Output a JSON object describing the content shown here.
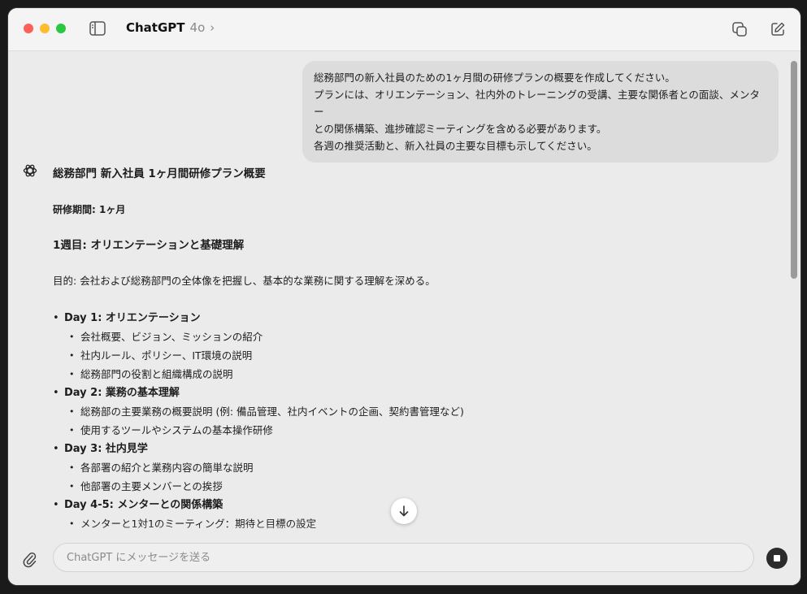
{
  "titlebar": {
    "app_name": "ChatGPT",
    "model": "4o",
    "model_chevron": "›"
  },
  "user_message": {
    "lines": [
      "総務部門の新入社員のための1ヶ月間の研修プランの概要を作成してください。",
      "プランには、オリエンテーション、社内外のトレーニングの受講、主要な関係者との面談、メンター",
      "との関係構築、進捗確認ミーティングを含める必要があります。",
      "各週の推奨活動と、新入社員の主要な目標も示してください。"
    ]
  },
  "assistant": {
    "title": "総務部門 新入社員 1ヶ月間研修プラン概要",
    "period": "研修期間: 1ヶ月",
    "week1_heading": "1週目: オリエンテーションと基礎理解",
    "purpose_label": "目的:",
    "purpose_text": " 会社および総務部門の全体像を把握し、基本的な業務に関する理解を深める。",
    "days": [
      {
        "label": "Day 1: オリエンテーション",
        "items": [
          "会社概要、ビジョン、ミッションの紹介",
          "社内ルール、ポリシー、IT環境の説明",
          "総務部門の役割と組織構成の説明"
        ]
      },
      {
        "label": "Day 2: 業務の基本理解",
        "items": [
          "総務部の主要業務の概要説明 (例: 備品管理、社内イベントの企画、契約書管理など)",
          "使用するツールやシステムの基本操作研修"
        ]
      },
      {
        "label": "Day 3: 社内見学",
        "items": [
          "各部署の紹介と業務内容の簡単な説明",
          "他部署の主要メンバーとの挨拶"
        ]
      },
      {
        "label": "Day 4-5: メンターとの関係構築",
        "items": [
          "メンターと1対1のミーティング：期待と目標の設定"
        ]
      }
    ]
  },
  "composer": {
    "placeholder": "ChatGPT にメッセージを送る"
  },
  "icons": {
    "sidebar": "sidebar-icon",
    "copy": "copy-window-icon",
    "new_chat": "new-chat-icon",
    "scroll_down": "arrow-down-icon",
    "attach": "paperclip-icon",
    "stop": "stop-icon",
    "assistant_logo": "openai-logo-icon"
  },
  "colors": {
    "window_bg": "#ebebeb",
    "titlebar_bg": "#f4f4f4",
    "user_bubble": "#dcdcdc",
    "close": "#fe5f57",
    "minimize": "#febc2e",
    "zoom": "#28c840"
  }
}
